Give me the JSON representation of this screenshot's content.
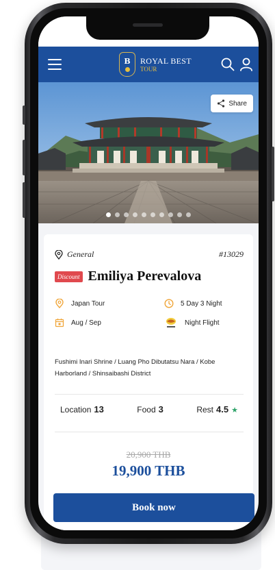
{
  "header": {
    "logo_title": "ROYAL BEST",
    "logo_sub": "TOUR"
  },
  "hero": {
    "share_label": "Share",
    "slide_count": 10,
    "active_slide": 1
  },
  "tour": {
    "category": "General",
    "code": "#13029",
    "discount_badge": "Discount",
    "title": "Emiliya Perevalova",
    "destination": "Japan Tour",
    "duration": "5 Day 3 Night",
    "travel_period": "Aug / Sep",
    "flight": "Night Flight",
    "itinerary": "Fushimi Inari Shrine / Luang Pho Dibutatsu Nara / Kobe Harborland / Shinsaibashi District",
    "ratings": {
      "location_label": "Location",
      "location_value": "13",
      "food_label": "Food",
      "food_value": "3",
      "rest_label": "Rest",
      "rest_value": "4.5"
    },
    "old_price": "20,900 THB",
    "price": "19,900 THB",
    "book_label": "Book now"
  },
  "colors": {
    "brand_blue": "#1c4f9c",
    "accent_gold": "#e7be3d",
    "discount_red": "#e0494e",
    "icon_orange": "#f0a63a",
    "star_green": "#2fa36a",
    "line_green": "#29b34a"
  },
  "icons": [
    "menu-icon",
    "search-icon",
    "user-icon",
    "share-icon",
    "location-pin-icon",
    "clock-icon",
    "calendar-icon",
    "airline-logo-icon",
    "star-icon"
  ]
}
